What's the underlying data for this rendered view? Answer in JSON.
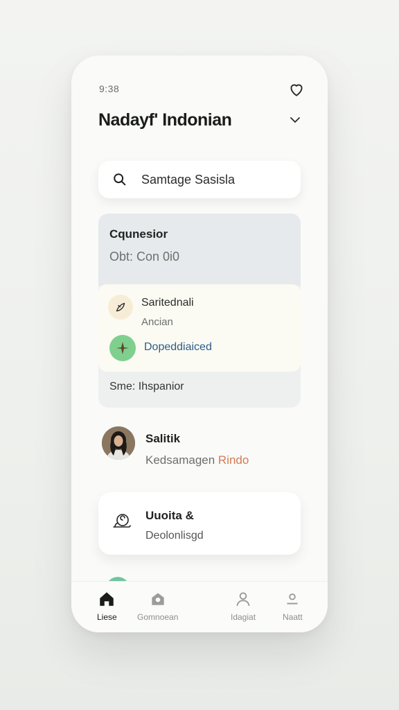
{
  "status": {
    "time": "9:38"
  },
  "header": {
    "title": "Nadayf' Indonian"
  },
  "search": {
    "value": "Samtage Sasisla"
  },
  "panel": {
    "title": "Cqunesior",
    "subtitle": "Obt: Con 0i0",
    "items": [
      {
        "label": "Saritednali",
        "sub": "Ancian",
        "icon": "leaf-icon"
      },
      {
        "label": "Dopeddiaiced",
        "icon": "star-plant-icon"
      }
    ],
    "footer": "Sme: Ihspanior"
  },
  "person": {
    "name": "Salitik",
    "sub_prefix": "Kedsamagen ",
    "sub_accent": "Rindo"
  },
  "card": {
    "title": "Uuoita &",
    "subtitle": "Deolonlisgd"
  },
  "nav": {
    "items": [
      {
        "label": "Liese",
        "icon": "home-icon",
        "active": true
      },
      {
        "label": "Gomnoean",
        "icon": "community-icon",
        "active": false
      },
      {
        "label": "Idagiat",
        "icon": "profile-icon",
        "active": false
      },
      {
        "label": "Naatt",
        "icon": "user-icon",
        "active": false
      }
    ]
  },
  "colors": {
    "link": "#2d5c87",
    "accent": "#d47a52",
    "green": "#7fcf8f",
    "teal": "#6fc6a0"
  }
}
